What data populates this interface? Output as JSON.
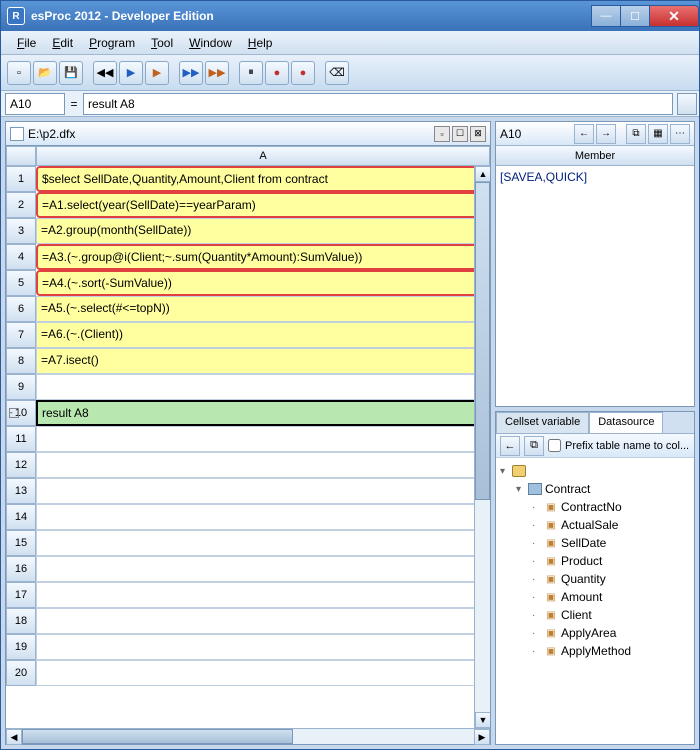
{
  "titlebar": {
    "app": "R",
    "title": "esProc 2012 - Developer Edition"
  },
  "menu": {
    "file": "File",
    "edit": "Edit",
    "program": "Program",
    "tool": "Tool",
    "window": "Window",
    "help": "Help"
  },
  "formulabar": {
    "cellref": "A10",
    "eq": "=",
    "formula": "result A8"
  },
  "doc": {
    "filename": "E:\\p2.dfx",
    "colA": "A"
  },
  "cells": {
    "r1": "$select SellDate,Quantity,Amount,Client from contract",
    "r2": "=A1.select(year(SellDate)==yearParam)",
    "r3": "=A2.group(month(SellDate))",
    "r4": "=A3.(~.group@i(Client;~.sum(Quantity*Amount):SumValue))",
    "r5": "=A4.(~.sort(-SumValue))",
    "r6": "=A5.(~.select(#<=topN))",
    "r7": "=A6.(~.(Client))",
    "r8": "=A7.isect()",
    "r10": "result A8"
  },
  "rownums": {
    "r1": "1",
    "r2": "2",
    "r3": "3",
    "r4": "4",
    "r5": "5",
    "r6": "6",
    "r7": "7",
    "r8": "8",
    "r9": "9",
    "r10": "10",
    "r11": "11",
    "r12": "12",
    "r13": "13",
    "r14": "14",
    "r15": "15",
    "r16": "16",
    "r17": "17",
    "r18": "18",
    "r19": "19",
    "r20": "20"
  },
  "nav": {
    "ref": "A10",
    "member_header": "Member",
    "member_value": "[SAVEA,QUICK]"
  },
  "tabs": {
    "cellset": "Cellset variable",
    "datasource": "Datasource"
  },
  "ds": {
    "prefix_label": "Prefix table name to col..."
  },
  "tree": {
    "table": "Contract",
    "fields": {
      "f1": "ContractNo",
      "f2": "ActualSale",
      "f3": "SellDate",
      "f4": "Product",
      "f5": "Quantity",
      "f6": "Amount",
      "f7": "Client",
      "f8": "ApplyArea",
      "f9": "ApplyMethod"
    }
  }
}
